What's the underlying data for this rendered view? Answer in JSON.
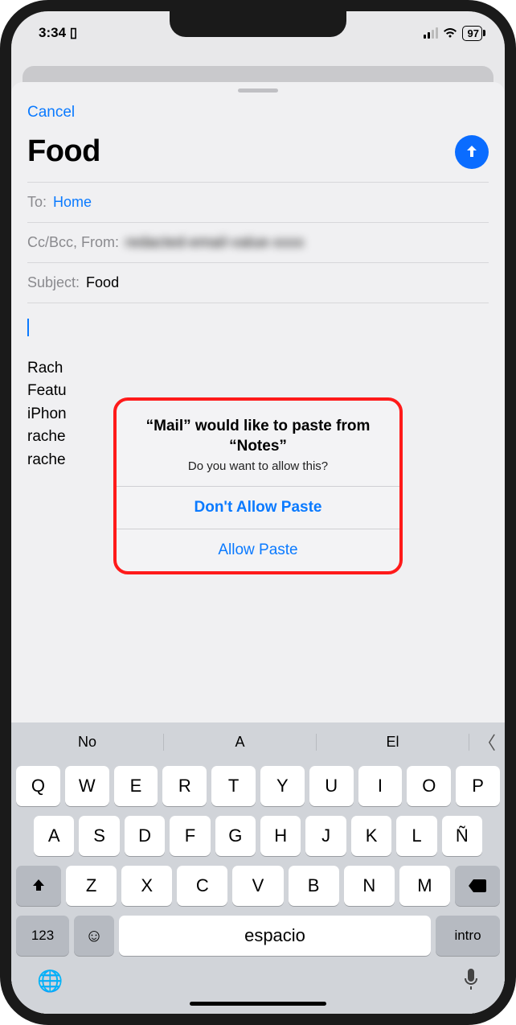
{
  "status": {
    "time": "3:34",
    "battery": "97"
  },
  "sheet": {
    "cancel": "Cancel",
    "title": "Food",
    "to_label": "To:",
    "to_value": "Home",
    "ccbcc_label": "Cc/Bcc, From:",
    "ccbcc_value": "redacted-email-value-xxxx",
    "subject_label": "Subject:",
    "subject_value": "Food",
    "signature": [
      "Rach",
      "Featu",
      "iPhon",
      "rache",
      "rache"
    ]
  },
  "alert": {
    "title": "“Mail” would like to paste from “Notes”",
    "message": "Do you want to allow this?",
    "deny": "Don't Allow Paste",
    "allow": "Allow Paste"
  },
  "keyboard": {
    "predict": [
      "No",
      "A",
      "El"
    ],
    "row1": [
      "Q",
      "W",
      "E",
      "R",
      "T",
      "Y",
      "U",
      "I",
      "O",
      "P"
    ],
    "row2": [
      "A",
      "S",
      "D",
      "F",
      "G",
      "H",
      "J",
      "K",
      "L",
      "Ñ"
    ],
    "row3": [
      "Z",
      "X",
      "C",
      "V",
      "B",
      "N",
      "M"
    ],
    "numbers": "123",
    "space": "espacio",
    "enter": "intro"
  }
}
